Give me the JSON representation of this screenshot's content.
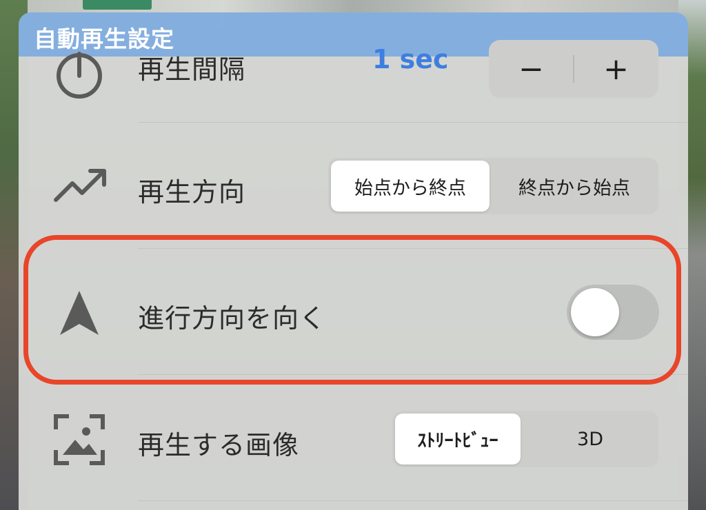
{
  "header": {
    "title": "自動再生設定"
  },
  "rows": {
    "interval": {
      "icon": "power-icon",
      "label": "再生間隔",
      "value": "1 sec",
      "minus_label": "−",
      "plus_label": "+"
    },
    "direction": {
      "icon": "trend-arrow-icon",
      "label": "再生方向",
      "options": [
        "始点から終点",
        "終点から始点"
      ],
      "selected": "始点から終点"
    },
    "heading": {
      "icon": "navigation-arrow-icon",
      "label": "進行方向を向く",
      "toggle_on": false
    },
    "image": {
      "icon": "image-frame-icon",
      "label": "再生する画像",
      "options": [
        "ｽﾄﾘｰﾄﾋﾞｭｰ",
        "3D"
      ],
      "selected": "ｽﾄﾘｰﾄﾋﾞｭｰ"
    }
  },
  "colors": {
    "accent": "#3d7fe0",
    "header": "#7daade",
    "highlight": "#e8452a"
  }
}
